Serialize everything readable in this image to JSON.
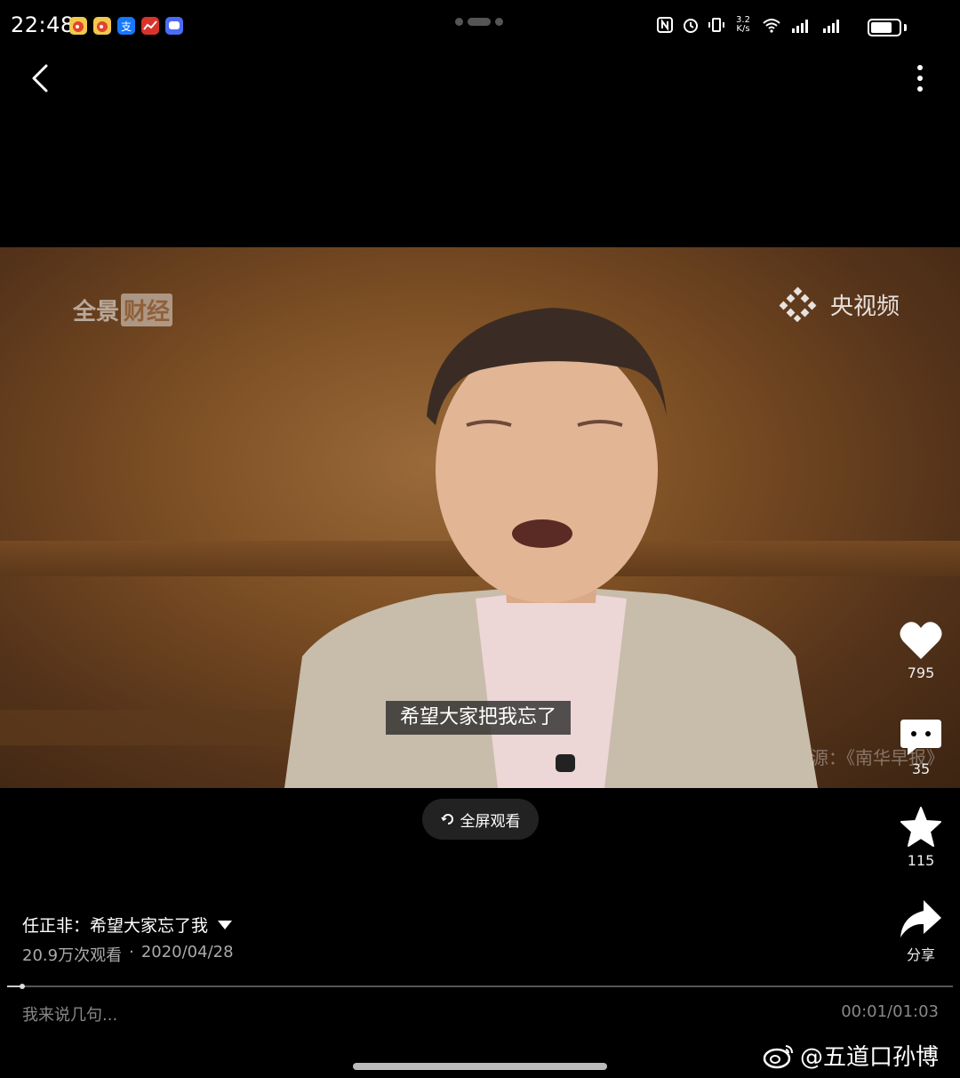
{
  "status_bar": {
    "time": "22:48",
    "net_speed_top": "3.2",
    "net_speed_bottom": "K/s",
    "battery_level": 0.8,
    "notification_icons": [
      "weibo-icon",
      "weibo-icon",
      "alipay-icon",
      "stock-app-icon",
      "chat-app-icon"
    ]
  },
  "video": {
    "watermark_left": "全景",
    "watermark_left_box": "财经",
    "watermark_right": "央视频",
    "subtitle": "希望大家把我忘了",
    "source_note": "源：《南华早报》"
  },
  "fullscreen_label": "全屏观看",
  "actions": {
    "like_count": "795",
    "comment_count": "35",
    "favorite_count": "115",
    "share_label": "分享"
  },
  "info": {
    "title": "任正非：希望大家忘了我",
    "views": "20.9万次观看",
    "separator": "·",
    "date": "2020/04/28"
  },
  "playback": {
    "progress": 0.016,
    "time": "00:01/01:03"
  },
  "comment_placeholder": "我来说几句...",
  "watermark": "@五道口孙博"
}
